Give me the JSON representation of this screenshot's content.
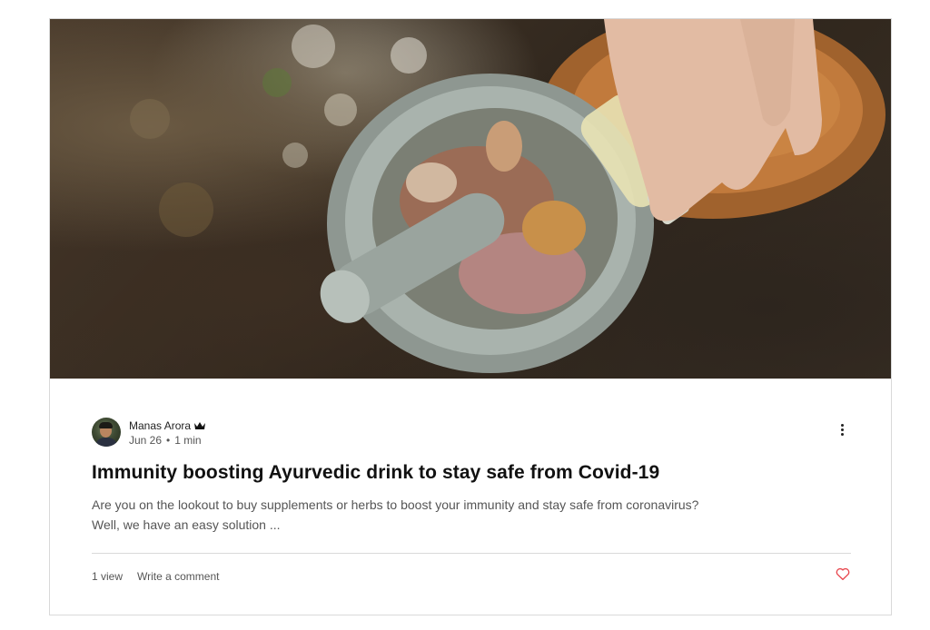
{
  "post": {
    "author": {
      "name": "Manas Arora",
      "badge_icon": "crown-icon"
    },
    "date": "Jun 26",
    "separator": "•",
    "read_time": "1 min",
    "title": "Immunity boosting Ayurvedic drink to stay safe from Covid-19",
    "excerpt_line1": "Are you on the lookout to buy supplements or herbs to boost your immunity and stay safe from coronavirus?",
    "excerpt_line2": "Well, we have an easy solution ...",
    "views": "1 view",
    "comment_link": "Write a comment",
    "more_icon": "more-options-icon",
    "like_icon": "heart-icon"
  },
  "colors": {
    "accent_heart": "#e8484f",
    "divider": "#d9d9d9",
    "card_border": "#d9d9d9"
  }
}
